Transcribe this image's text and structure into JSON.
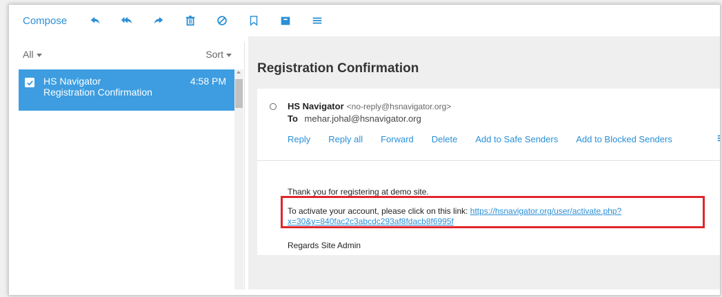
{
  "toolbar": {
    "compose_label": "Compose",
    "icons": [
      "reply-icon",
      "reply-all-icon",
      "forward-icon",
      "delete-icon",
      "block-icon",
      "flag-icon",
      "archive-icon",
      "menu-icon"
    ],
    "accent": "#2a8fd6"
  },
  "list": {
    "filter_label": "All",
    "sort_label": "Sort",
    "items": [
      {
        "sender": "HS Navigator",
        "subject": "Registration Confirmation",
        "time": "4:58 PM",
        "selected": true
      }
    ],
    "selected_color": "#3d9de0"
  },
  "message": {
    "title": "Registration Confirmation",
    "from_name": "HS Navigator",
    "from_email": "<no-reply@hsnavigator.org>",
    "to_label": "To",
    "to_email": "mehar.johal@hsnavigator.org",
    "actions": [
      "Reply",
      "Reply all",
      "Forward",
      "Delete",
      "Add to Safe Senders",
      "Add to Blocked Senders"
    ],
    "body_line1": "Thank you for registering at demo site.",
    "body_link_prefix": "To activate your account, please click on this link: ",
    "body_link_part1": "https://hsnavigator.org/user/activate.php?",
    "body_link_part2": "x=30&y=840fac2c3abcdc293af8fdacb8f6995f",
    "signature": "Regards Site Admin",
    "highlight_color": "#e0252b"
  }
}
